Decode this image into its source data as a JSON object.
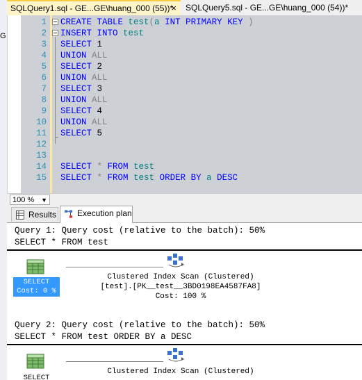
{
  "tabs": [
    {
      "label": "SQLQuery1.sql - GE...GE\\huang_000 (55))*",
      "close": "×"
    },
    {
      "label": "SQLQuery5.sql - GE...GE\\huang_000 (54))*"
    }
  ],
  "left_strip_text": "G",
  "editor": {
    "lines": [
      {
        "n": "1",
        "parts": [
          [
            "kw",
            "CREATE TABLE "
          ],
          [
            "id",
            "test"
          ],
          [
            "op",
            "("
          ],
          [
            "id",
            "a "
          ],
          [
            "kw",
            "INT PRIMARY KEY "
          ],
          [
            "op",
            ")"
          ]
        ]
      },
      {
        "n": "2",
        "parts": [
          [
            "kw",
            "INSERT INTO "
          ],
          [
            "id",
            "test"
          ]
        ]
      },
      {
        "n": "3",
        "parts": [
          [
            "kw",
            "SELECT "
          ],
          [
            "tx",
            "1"
          ]
        ]
      },
      {
        "n": "4",
        "parts": [
          [
            "kw",
            "UNION "
          ],
          [
            "op",
            "ALL"
          ]
        ]
      },
      {
        "n": "5",
        "parts": [
          [
            "kw",
            "SELECT "
          ],
          [
            "tx",
            "2"
          ]
        ]
      },
      {
        "n": "6",
        "parts": [
          [
            "kw",
            "UNION "
          ],
          [
            "op",
            "ALL"
          ]
        ]
      },
      {
        "n": "7",
        "parts": [
          [
            "kw",
            "SELECT "
          ],
          [
            "tx",
            "3"
          ]
        ]
      },
      {
        "n": "8",
        "parts": [
          [
            "kw",
            "UNION "
          ],
          [
            "op",
            "ALL"
          ]
        ]
      },
      {
        "n": "9",
        "parts": [
          [
            "kw",
            "SELECT "
          ],
          [
            "tx",
            "4"
          ]
        ]
      },
      {
        "n": "10",
        "parts": [
          [
            "kw",
            "UNION "
          ],
          [
            "op",
            "ALL"
          ]
        ]
      },
      {
        "n": "11",
        "parts": [
          [
            "kw",
            "SELECT "
          ],
          [
            "tx",
            "5"
          ]
        ]
      },
      {
        "n": "12",
        "parts": []
      },
      {
        "n": "13",
        "parts": []
      },
      {
        "n": "14",
        "parts": [
          [
            "kw",
            "SELECT "
          ],
          [
            "op",
            "* "
          ],
          [
            "kw",
            "FROM "
          ],
          [
            "id",
            "test"
          ]
        ]
      },
      {
        "n": "15",
        "parts": [
          [
            "kw",
            "SELECT "
          ],
          [
            "op",
            "* "
          ],
          [
            "kw",
            "FROM "
          ],
          [
            "id",
            "test "
          ],
          [
            "kw",
            "ORDER BY "
          ],
          [
            "id",
            "a "
          ],
          [
            "kw",
            "DESC"
          ]
        ]
      }
    ]
  },
  "zoom": "100 %",
  "result_tabs": {
    "results": "Results",
    "plan": "Execution plan"
  },
  "plan": {
    "q1_header": "Query 1: Query cost (relative to the batch): 50%",
    "q1_sql": "SELECT * FROM test",
    "q1_select_label": "SELECT",
    "q1_select_cost": "Cost: 0 %",
    "q1_scan_title": "Clustered Index Scan (Clustered)",
    "q1_scan_object": "[test].[PK__test__3BD0198EA4587FA8]",
    "q1_scan_cost": "Cost: 100 %",
    "q2_header": "Query 2: Query cost (relative to the batch): 50%",
    "q2_sql": "SELECT * FROM test ORDER BY a DESC",
    "q2_select_label": "SELECT",
    "q2_scan_title": "Clustered Index Scan (Clustered)"
  },
  "colors": {
    "keyword": "#0000ff",
    "identifier": "#008080",
    "operator": "#808080",
    "selection": "#3399ff",
    "active_tab": "#fdf5c9"
  },
  "icons": [
    "close-icon",
    "results-grid-icon",
    "execution-plan-icon",
    "select-operator-icon",
    "clustered-index-scan-icon",
    "dropdown-arrow-icon"
  ]
}
